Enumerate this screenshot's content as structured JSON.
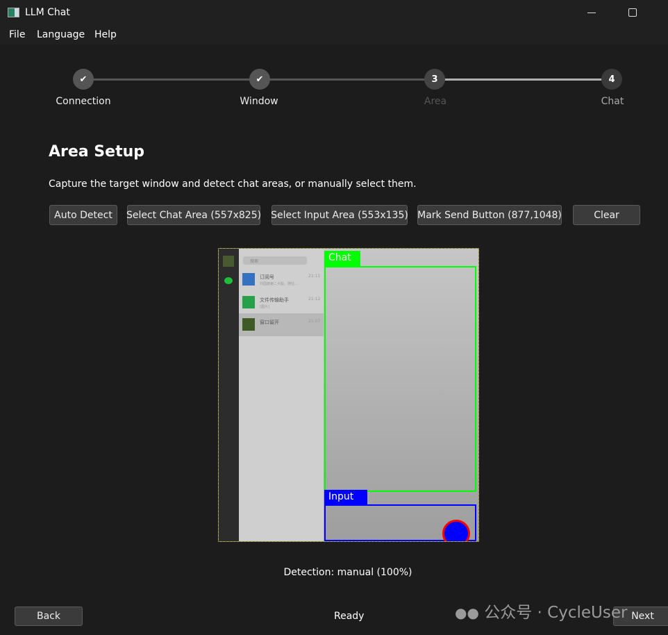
{
  "window": {
    "title": "LLM Chat"
  },
  "menu": [
    "File",
    "Language",
    "Help"
  ],
  "steps": [
    {
      "label": "Connection",
      "state": "done"
    },
    {
      "label": "Window",
      "state": "done"
    },
    {
      "label": "Area",
      "number": "3",
      "state": "current"
    },
    {
      "label": "Chat",
      "number": "4",
      "state": "pending"
    }
  ],
  "page": {
    "title": "Area Setup",
    "description": "Capture the target window and detect chat areas, or manually select them."
  },
  "buttons": {
    "auto_detect": "Auto Detect",
    "select_chat": "Select Chat Area (557x825)",
    "select_input": "Select Input Area (553x135)",
    "mark_send": "Mark Send Button (877,1048)",
    "clear": "Clear"
  },
  "preview": {
    "chat_label": "Chat",
    "input_label": "Input",
    "chat_color": "#00ff00",
    "input_color": "#0000ff",
    "send_marker_color": "#ff0000",
    "search_placeholder": "搜索",
    "contacts": [
      {
        "name": "订阅号",
        "time": "21:11",
        "preview": "刘国旗第二大股，随往..."
      },
      {
        "name": "文件传输助手",
        "time": "21:12",
        "preview": "[图片]"
      },
      {
        "name": "窗口留开",
        "time": "21:07",
        "preview": ""
      }
    ]
  },
  "detection": "Detection: manual (100%)",
  "footer": {
    "back": "Back",
    "status": "Ready",
    "next": "Next",
    "watermark": "公众号 · CycleUser"
  }
}
